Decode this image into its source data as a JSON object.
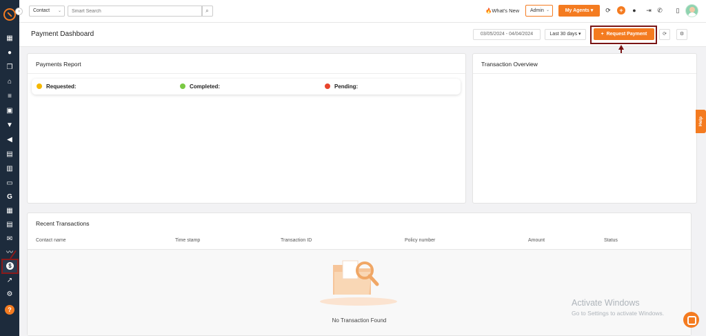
{
  "topbar": {
    "contact_select": "Contact",
    "search_placeholder": "Smart Search",
    "whats_new": "What's New",
    "admin_select": "Admin",
    "my_agents": "My Agents",
    "plus": "+"
  },
  "header": {
    "title": "Payment Dashboard",
    "date_range": "03/05/2024 - 04/04/2024",
    "period": "Last 30 days",
    "request_payment": "Request Payment"
  },
  "payments_report": {
    "title": "Payments Report",
    "legend": [
      {
        "label": "Requested:",
        "color": "#f5b800"
      },
      {
        "label": "Completed:",
        "color": "#7ac943"
      },
      {
        "label": "Pending:",
        "color": "#e8452c"
      }
    ]
  },
  "transaction_overview": {
    "title": "Transaction Overview"
  },
  "recent_transactions": {
    "title": "Recent Transactions",
    "columns": [
      "Contact name",
      "Time stamp",
      "Transaction ID",
      "Policy number",
      "Amount",
      "Status"
    ],
    "empty_text": "No Transaction Found"
  },
  "help_tab": "Help",
  "watermark": {
    "line1": "Activate Windows",
    "line2": "Go to Settings to activate Windows."
  },
  "colors": {
    "accent": "#f47b20",
    "sidebar": "#1d2b3c",
    "annotation": "#7a1414"
  },
  "sidebar_icons": [
    "dashboard-icon",
    "contacts-icon",
    "documents-icon",
    "bank-icon",
    "list-icon",
    "id-card-icon",
    "funnel-icon",
    "megaphone-icon",
    "notes-icon",
    "stats-icon",
    "folder-icon",
    "google-icon",
    "calculator-icon",
    "calendar-icon",
    "mail-icon",
    "signature-icon",
    "payments-icon",
    "chart-icon",
    "settings-icon",
    "help-icon"
  ]
}
